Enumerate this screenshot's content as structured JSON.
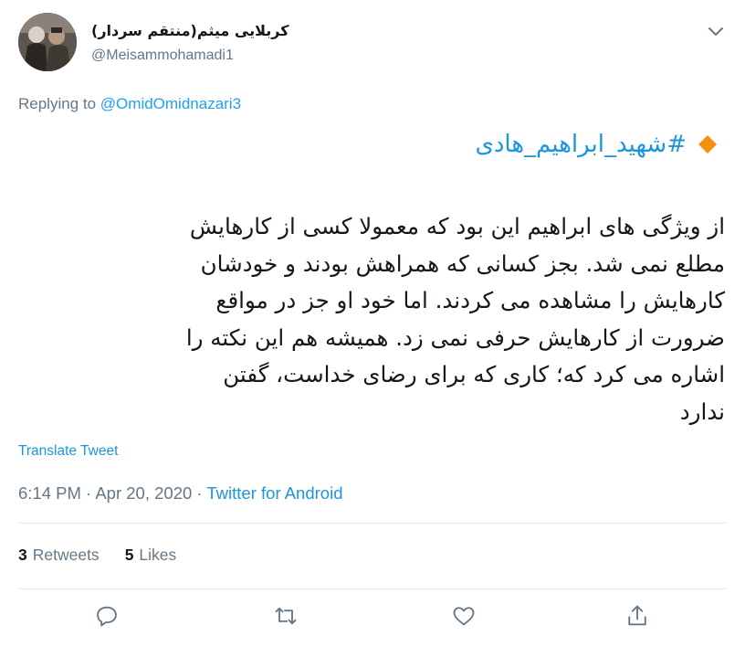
{
  "user": {
    "display_name": "کربلایی میثم(منتقم سردار)",
    "handle": "@Meisammohamadi1",
    "avatar": "avatar-photo"
  },
  "reply": {
    "prefix": "Replying to",
    "to": "@OmidOmidnazari3"
  },
  "tweet": {
    "hashtag": "#شهید_ابراهیم_هادی",
    "bullet_icon": "orange-diamond-icon",
    "lines": [
      "از ویژگی های ابراهیم این بود که معمولا کسی از کارهایش",
      "مطلع نمی شد. بجز کسانی که همراهش بودند و خودشان",
      "کارهایش را مشاهده می کردند. اما خود او جز در مواقع",
      "ضرورت از کارهایش حرفی نمی زد. همیشه هم این نکته را",
      "اشاره می کرد که؛ کاری که برای رضای خداست، گفتن",
      "ندارد"
    ]
  },
  "translate_label": "Translate Tweet",
  "meta": {
    "time": "6:14 PM",
    "sep1": " · ",
    "date": "Apr 20, 2020",
    "sep2": " · ",
    "source": "Twitter for Android"
  },
  "stats": {
    "retweets_count": "3",
    "retweets_label": "Retweets",
    "likes_count": "5",
    "likes_label": "Likes"
  },
  "actions": [
    "reply-icon",
    "retweet-icon",
    "like-icon",
    "share-icon"
  ],
  "colors": {
    "link": "#1b95e0",
    "muted": "#657786",
    "text": "#14171a",
    "divider": "#e6ecf0",
    "diamond": "#f4900c"
  }
}
